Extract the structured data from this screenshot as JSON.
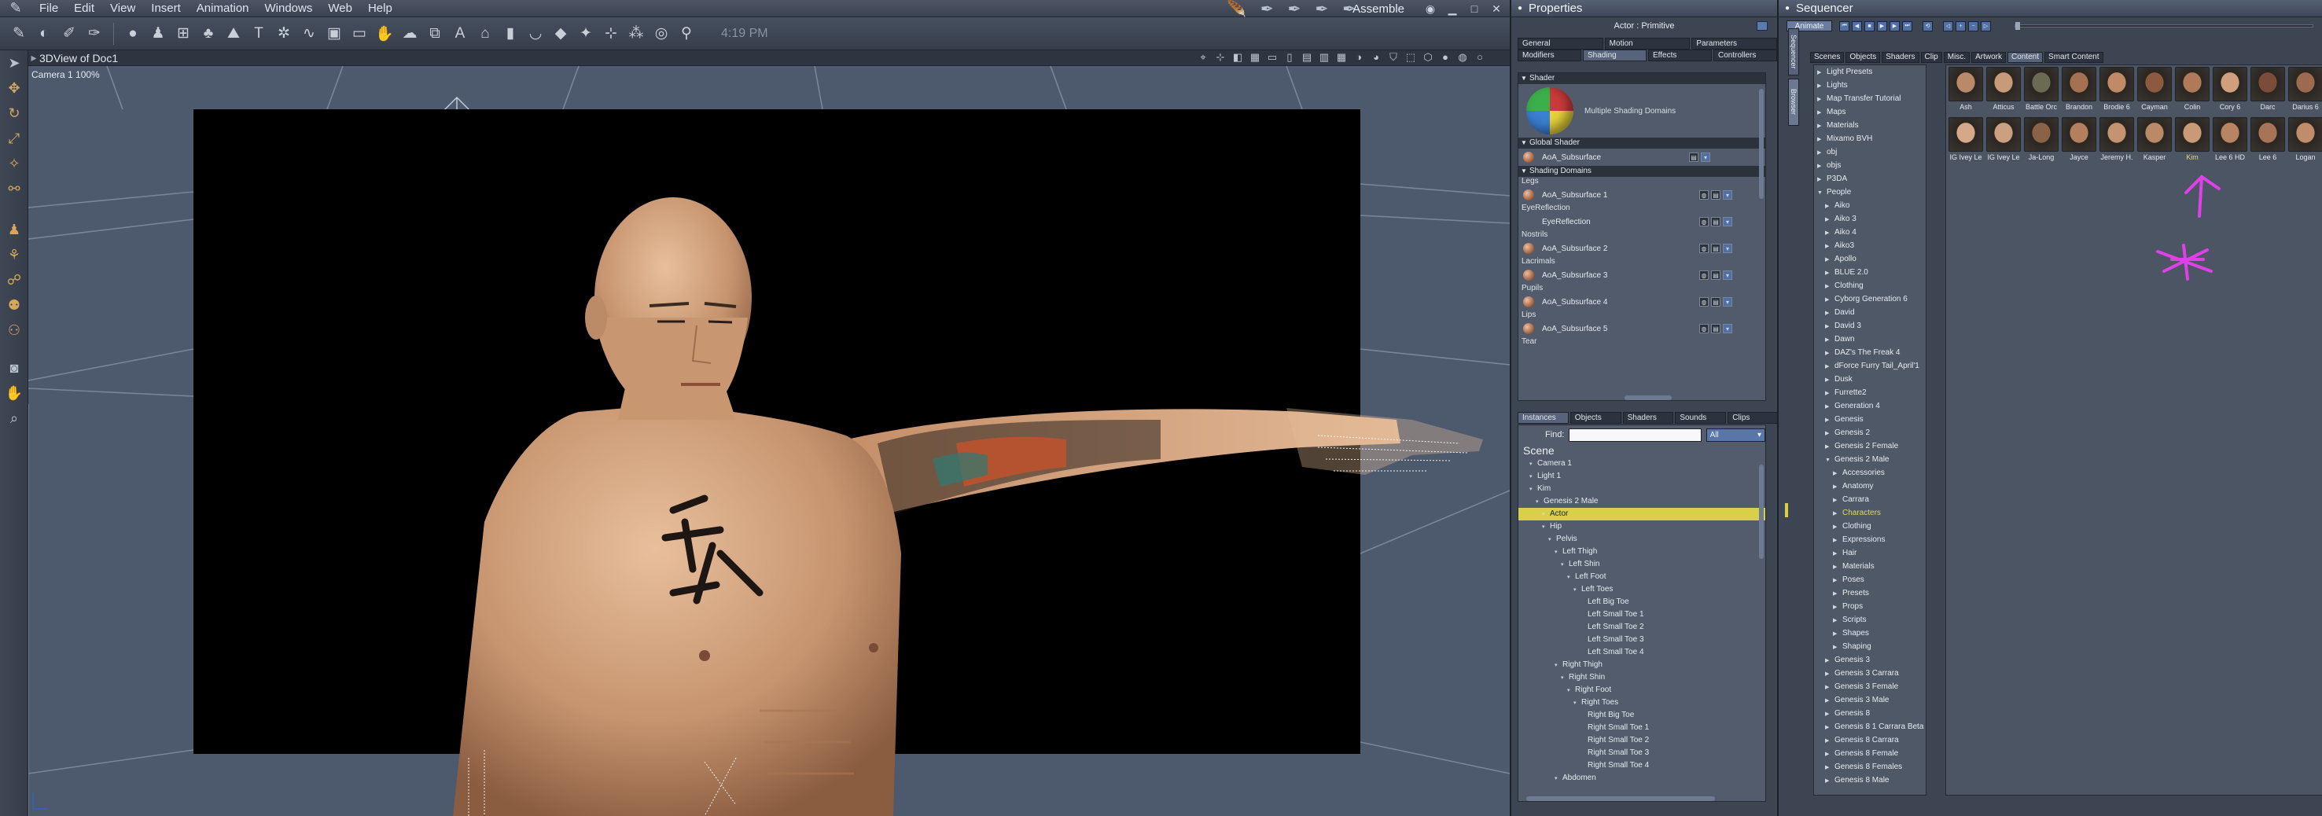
{
  "menubar": {
    "items": [
      "File",
      "Edit",
      "View",
      "Insert",
      "Animation",
      "Windows",
      "Web",
      "Help"
    ],
    "room": "Assemble"
  },
  "toolbar": {
    "clock": "4:19 PM"
  },
  "viewport": {
    "title": "3DView of Doc1",
    "camera_label": "Camera 1 100%"
  },
  "properties": {
    "title": "Properties",
    "actor_label": "Actor : Primitive",
    "tabs_row1": [
      "General",
      "Motion",
      "Parameters"
    ],
    "tabs_row2": [
      "Modifiers",
      "Shading",
      "Effects",
      "Controllers"
    ],
    "active_tab": "Shading",
    "shader_section": "Shader",
    "shader_name": "Multiple Shading Domains",
    "global_section": "Global Shader",
    "global_shader": "AoA_Subsurface",
    "domains_section": "Shading Domains",
    "domains": [
      {
        "label": "Legs",
        "shader": "AoA_Subsurface 1"
      },
      {
        "label": "EyeReflection",
        "shader": "EyeReflection"
      },
      {
        "label": "Nostrils",
        "shader": "AoA_Subsurface 2"
      },
      {
        "label": "Lacrimals",
        "shader": "AoA_Subsurface 3"
      },
      {
        "label": "Pupils",
        "shader": "AoA_Subsurface 4"
      },
      {
        "label": "Lips",
        "shader": "AoA_Subsurface 5"
      },
      {
        "label": "Tear",
        "shader": ""
      }
    ]
  },
  "scene": {
    "tabs": [
      "Instances",
      "Objects",
      "Shaders",
      "Sounds",
      "Clips"
    ],
    "active_tab": "Instances",
    "find_label": "Find:",
    "find_value": "",
    "filter": "All",
    "title": "Scene",
    "nodes": [
      {
        "label": "Camera 1",
        "d": 1
      },
      {
        "label": "Light 1",
        "d": 1
      },
      {
        "label": "Kim",
        "d": 1
      },
      {
        "label": "Genesis 2 Male",
        "d": 2
      },
      {
        "label": "Actor",
        "d": 3
      },
      {
        "label": "Hip",
        "d": 3
      },
      {
        "label": "Pelvis",
        "d": 4
      },
      {
        "label": "Left Thigh",
        "d": 5
      },
      {
        "label": "Left Shin",
        "d": 6
      },
      {
        "label": "Left Foot",
        "d": 7
      },
      {
        "label": "Left Toes",
        "d": 8
      },
      {
        "label": "Left Big Toe",
        "d": 9
      },
      {
        "label": "Left Small Toe 1",
        "d": 9
      },
      {
        "label": "Left Small Toe 2",
        "d": 9
      },
      {
        "label": "Left Small Toe 3",
        "d": 9
      },
      {
        "label": "Left Small Toe 4",
        "d": 9
      },
      {
        "label": "Right Thigh",
        "d": 5
      },
      {
        "label": "Right Shin",
        "d": 6
      },
      {
        "label": "Right Foot",
        "d": 7
      },
      {
        "label": "Right Toes",
        "d": 8
      },
      {
        "label": "Right Big Toe",
        "d": 9
      },
      {
        "label": "Right Small Toe 1",
        "d": 9
      },
      {
        "label": "Right Small Toe 2",
        "d": 9
      },
      {
        "label": "Right Small Toe 3",
        "d": 9
      },
      {
        "label": "Right Small Toe 4",
        "d": 9
      },
      {
        "label": "Abdomen",
        "d": 5
      }
    ],
    "selected": "Actor"
  },
  "sequencer": {
    "title": "Sequencer",
    "animate": "Animate",
    "side_tabs": [
      "Sequencer",
      "Browser"
    ],
    "tabs": [
      "Scenes",
      "Objects",
      "Shaders",
      "Clip",
      "Misc.",
      "Artwork",
      "Content",
      "Smart Content"
    ],
    "active_tab": "Content",
    "library": [
      {
        "label": "Light Presets",
        "d": 0
      },
      {
        "label": "Lights",
        "d": 0
      },
      {
        "label": "Map Transfer Tutorial",
        "d": 0
      },
      {
        "label": "Maps",
        "d": 0
      },
      {
        "label": "Materials",
        "d": 0
      },
      {
        "label": "Mixamo BVH",
        "d": 0
      },
      {
        "label": "obj",
        "d": 0
      },
      {
        "label": "objs",
        "d": 0
      },
      {
        "label": "P3DA",
        "d": 0
      },
      {
        "label": "People",
        "d": 0,
        "open": true
      },
      {
        "label": "Aiko",
        "d": 1
      },
      {
        "label": "Aiko 3",
        "d": 1
      },
      {
        "label": "Aiko 4",
        "d": 1
      },
      {
        "label": "Aiko3",
        "d": 1
      },
      {
        "label": "Apollo",
        "d": 1
      },
      {
        "label": "BLUE 2.0",
        "d": 1
      },
      {
        "label": "Clothing",
        "d": 1
      },
      {
        "label": "Cyborg Generation 6",
        "d": 1
      },
      {
        "label": "David",
        "d": 1
      },
      {
        "label": "David 3",
        "d": 1
      },
      {
        "label": "Dawn",
        "d": 1
      },
      {
        "label": "DAZ's The Freak 4",
        "d": 1
      },
      {
        "label": "dForce Furry Tail_April'1",
        "d": 1
      },
      {
        "label": "Dusk",
        "d": 1
      },
      {
        "label": "Furrette2",
        "d": 1
      },
      {
        "label": "Generation 4",
        "d": 1
      },
      {
        "label": "Genesis",
        "d": 1
      },
      {
        "label": "Genesis 2",
        "d": 1
      },
      {
        "label": "Genesis 2 Female",
        "d": 1
      },
      {
        "label": "Genesis 2 Male",
        "d": 1,
        "open": true
      },
      {
        "label": "Accessories",
        "d": 2
      },
      {
        "label": "Anatomy",
        "d": 2
      },
      {
        "label": "Carrara",
        "d": 2
      },
      {
        "label": "Characters",
        "d": 2,
        "sel": true
      },
      {
        "label": "Clothing",
        "d": 2
      },
      {
        "label": "Expressions",
        "d": 2
      },
      {
        "label": "Hair",
        "d": 2
      },
      {
        "label": "Materials",
        "d": 2
      },
      {
        "label": "Poses",
        "d": 2
      },
      {
        "label": "Presets",
        "d": 2
      },
      {
        "label": "Props",
        "d": 2
      },
      {
        "label": "Scripts",
        "d": 2
      },
      {
        "label": "Shapes",
        "d": 2
      },
      {
        "label": "Shaping",
        "d": 2
      },
      {
        "label": "Genesis 3",
        "d": 1
      },
      {
        "label": "Genesis 3 Carrara",
        "d": 1
      },
      {
        "label": "Genesis 3 Female",
        "d": 1
      },
      {
        "label": "Genesis 3 Male",
        "d": 1
      },
      {
        "label": "Genesis 8",
        "d": 1
      },
      {
        "label": "Genesis 8 1 Carrara Beta",
        "d": 1
      },
      {
        "label": "Genesis 8 Carrara",
        "d": 1
      },
      {
        "label": "Genesis 8 Female",
        "d": 1
      },
      {
        "label": "Genesis 8 Females",
        "d": 1
      },
      {
        "label": "Genesis 8 Male",
        "d": 1
      }
    ],
    "thumbs_row1": [
      "Ash",
      "Atticus",
      "Battle Orc",
      "Brandon",
      "Brodie 6",
      "Cayman",
      "Colin",
      "Cory 6",
      "Darc",
      "Darius 6"
    ],
    "thumbs_row2": [
      "IG Ivey Le",
      "IG Ivey Le",
      "Ja-Long",
      "Jayce",
      "Jeremy H.",
      "Kasper",
      "Kim",
      "Lee 6 HD",
      "Lee 6",
      "Logan"
    ],
    "selected_thumb": "Kim",
    "skin_colors_row1": [
      "#b88a6a",
      "#c79a7a",
      "#6b6a52",
      "#a67152",
      "#c08a66",
      "#8c5a3e",
      "#b07a5a",
      "#d0a07e",
      "#7c4c3a",
      "#9c6a4e"
    ],
    "skin_colors_row2": [
      "#d4a888",
      "#caa080",
      "#8a6246",
      "#b2805e",
      "#c49470",
      "#ba8a68",
      "#c89a76",
      "#b88462",
      "#a87458",
      "#c08c6a"
    ]
  }
}
